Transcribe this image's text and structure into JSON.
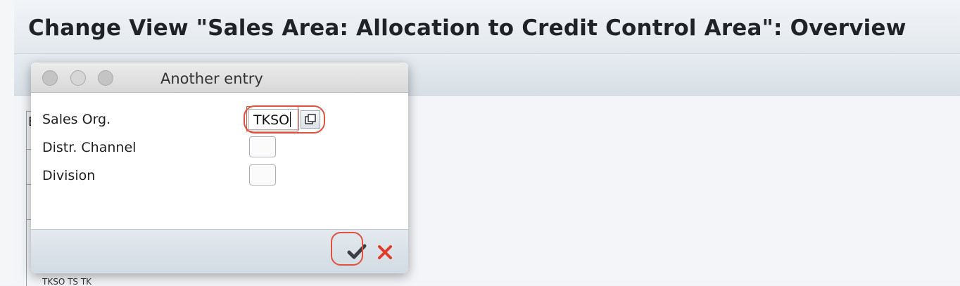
{
  "window": {
    "title": "Change View \"Sales Area: Allocation to Credit Control Area\": Overview"
  },
  "background": {
    "table_fragment_char": "E",
    "bottom_row_text": "TKSO  TS  TK"
  },
  "dialog": {
    "title": "Another entry",
    "fields": [
      {
        "label": "Sales Org.",
        "value": "TKSO"
      },
      {
        "label": "Distr. Channel",
        "value": ""
      },
      {
        "label": "Division",
        "value": ""
      }
    ],
    "buttons": {
      "ok_icon": "checkmark-icon",
      "cancel_icon": "cancel-x-icon"
    }
  },
  "colors": {
    "annotation_red": "#e0523f",
    "cancel_red": "#e23a2a",
    "ok_dark": "#3b3f44"
  }
}
